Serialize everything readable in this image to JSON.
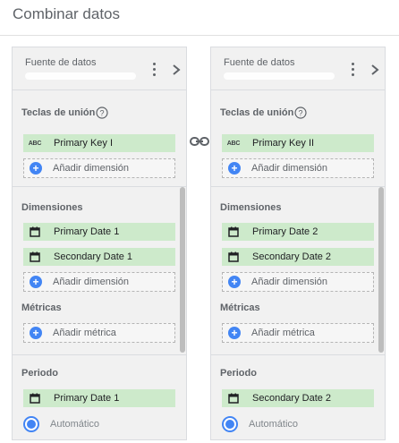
{
  "header": {
    "title": "Combinar datos"
  },
  "link_icon": "link-icon",
  "panels": [
    {
      "source_label": "Fuente de datos",
      "join": {
        "title": "Teclas de unión",
        "chip_icon": "ABC",
        "key": "Primary Key I",
        "add_label": "Añadir dimensión"
      },
      "dimensions": {
        "title": "Dimensiones",
        "items": [
          "Primary Date 1",
          "Secondary Date 1"
        ],
        "add_label": "Añadir dimensión"
      },
      "metrics": {
        "title": "Métricas",
        "add_label": "Añadir métrica"
      },
      "period": {
        "title": "Periodo",
        "value": "Primary Date 1",
        "radio_label": "Automático"
      }
    },
    {
      "source_label": "Fuente de datos",
      "join": {
        "title": "Teclas de unión",
        "chip_icon": "ABC",
        "key": "Primary Key II",
        "add_label": "Añadir dimensión"
      },
      "dimensions": {
        "title": "Dimensiones",
        "items": [
          "Primary Date 2",
          "Secondary Date 2"
        ],
        "add_label": "Añadir dimensión"
      },
      "metrics": {
        "title": "Métricas",
        "add_label": "Añadir métrica"
      },
      "period": {
        "title": "Periodo",
        "value": "Secondary Date 2",
        "radio_label": "Automático"
      }
    }
  ],
  "colors": {
    "accent": "#4285f4",
    "chip": "#cdeacb",
    "panel": "#f1f1f1"
  }
}
